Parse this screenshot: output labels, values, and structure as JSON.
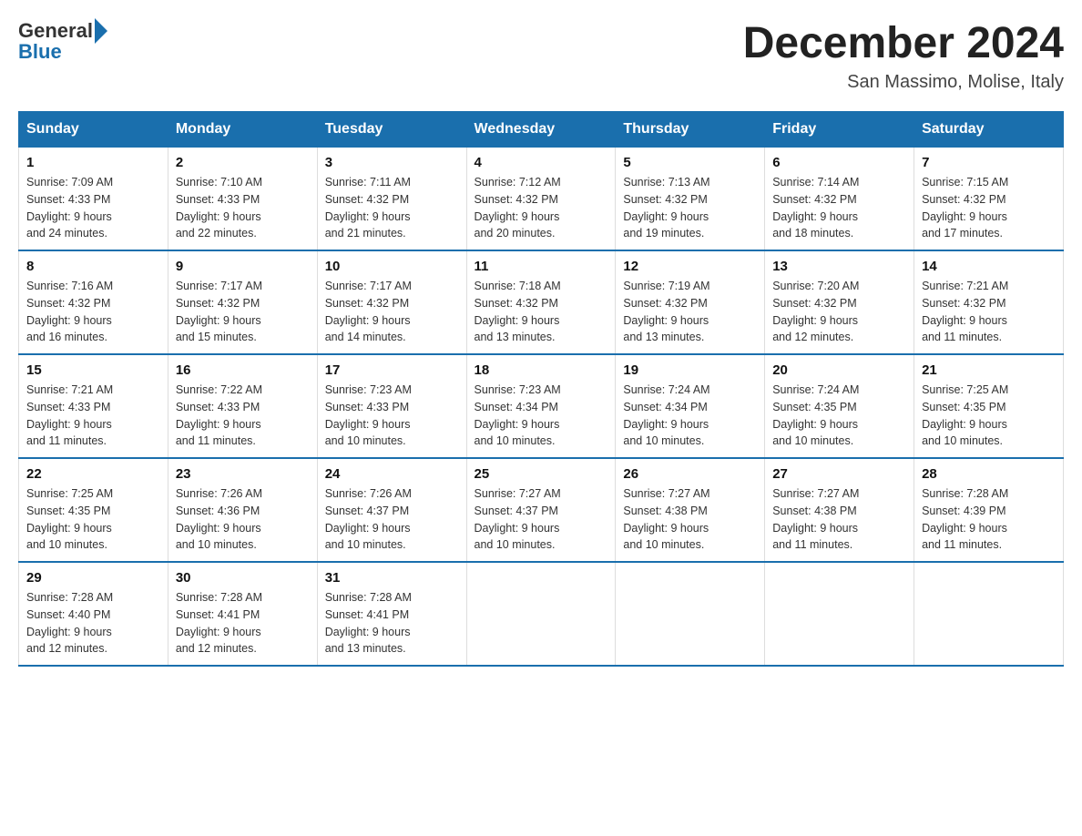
{
  "header": {
    "logo_general": "General",
    "logo_blue": "Blue",
    "month_title": "December 2024",
    "location": "San Massimo, Molise, Italy"
  },
  "weekdays": [
    "Sunday",
    "Monday",
    "Tuesday",
    "Wednesday",
    "Thursday",
    "Friday",
    "Saturday"
  ],
  "weeks": [
    [
      {
        "day": "1",
        "sunrise": "7:09 AM",
        "sunset": "4:33 PM",
        "daylight": "9 hours and 24 minutes."
      },
      {
        "day": "2",
        "sunrise": "7:10 AM",
        "sunset": "4:33 PM",
        "daylight": "9 hours and 22 minutes."
      },
      {
        "day": "3",
        "sunrise": "7:11 AM",
        "sunset": "4:32 PM",
        "daylight": "9 hours and 21 minutes."
      },
      {
        "day": "4",
        "sunrise": "7:12 AM",
        "sunset": "4:32 PM",
        "daylight": "9 hours and 20 minutes."
      },
      {
        "day": "5",
        "sunrise": "7:13 AM",
        "sunset": "4:32 PM",
        "daylight": "9 hours and 19 minutes."
      },
      {
        "day": "6",
        "sunrise": "7:14 AM",
        "sunset": "4:32 PM",
        "daylight": "9 hours and 18 minutes."
      },
      {
        "day": "7",
        "sunrise": "7:15 AM",
        "sunset": "4:32 PM",
        "daylight": "9 hours and 17 minutes."
      }
    ],
    [
      {
        "day": "8",
        "sunrise": "7:16 AM",
        "sunset": "4:32 PM",
        "daylight": "9 hours and 16 minutes."
      },
      {
        "day": "9",
        "sunrise": "7:17 AM",
        "sunset": "4:32 PM",
        "daylight": "9 hours and 15 minutes."
      },
      {
        "day": "10",
        "sunrise": "7:17 AM",
        "sunset": "4:32 PM",
        "daylight": "9 hours and 14 minutes."
      },
      {
        "day": "11",
        "sunrise": "7:18 AM",
        "sunset": "4:32 PM",
        "daylight": "9 hours and 13 minutes."
      },
      {
        "day": "12",
        "sunrise": "7:19 AM",
        "sunset": "4:32 PM",
        "daylight": "9 hours and 13 minutes."
      },
      {
        "day": "13",
        "sunrise": "7:20 AM",
        "sunset": "4:32 PM",
        "daylight": "9 hours and 12 minutes."
      },
      {
        "day": "14",
        "sunrise": "7:21 AM",
        "sunset": "4:32 PM",
        "daylight": "9 hours and 11 minutes."
      }
    ],
    [
      {
        "day": "15",
        "sunrise": "7:21 AM",
        "sunset": "4:33 PM",
        "daylight": "9 hours and 11 minutes."
      },
      {
        "day": "16",
        "sunrise": "7:22 AM",
        "sunset": "4:33 PM",
        "daylight": "9 hours and 11 minutes."
      },
      {
        "day": "17",
        "sunrise": "7:23 AM",
        "sunset": "4:33 PM",
        "daylight": "9 hours and 10 minutes."
      },
      {
        "day": "18",
        "sunrise": "7:23 AM",
        "sunset": "4:34 PM",
        "daylight": "9 hours and 10 minutes."
      },
      {
        "day": "19",
        "sunrise": "7:24 AM",
        "sunset": "4:34 PM",
        "daylight": "9 hours and 10 minutes."
      },
      {
        "day": "20",
        "sunrise": "7:24 AM",
        "sunset": "4:35 PM",
        "daylight": "9 hours and 10 minutes."
      },
      {
        "day": "21",
        "sunrise": "7:25 AM",
        "sunset": "4:35 PM",
        "daylight": "9 hours and 10 minutes."
      }
    ],
    [
      {
        "day": "22",
        "sunrise": "7:25 AM",
        "sunset": "4:35 PM",
        "daylight": "9 hours and 10 minutes."
      },
      {
        "day": "23",
        "sunrise": "7:26 AM",
        "sunset": "4:36 PM",
        "daylight": "9 hours and 10 minutes."
      },
      {
        "day": "24",
        "sunrise": "7:26 AM",
        "sunset": "4:37 PM",
        "daylight": "9 hours and 10 minutes."
      },
      {
        "day": "25",
        "sunrise": "7:27 AM",
        "sunset": "4:37 PM",
        "daylight": "9 hours and 10 minutes."
      },
      {
        "day": "26",
        "sunrise": "7:27 AM",
        "sunset": "4:38 PM",
        "daylight": "9 hours and 10 minutes."
      },
      {
        "day": "27",
        "sunrise": "7:27 AM",
        "sunset": "4:38 PM",
        "daylight": "9 hours and 11 minutes."
      },
      {
        "day": "28",
        "sunrise": "7:28 AM",
        "sunset": "4:39 PM",
        "daylight": "9 hours and 11 minutes."
      }
    ],
    [
      {
        "day": "29",
        "sunrise": "7:28 AM",
        "sunset": "4:40 PM",
        "daylight": "9 hours and 12 minutes."
      },
      {
        "day": "30",
        "sunrise": "7:28 AM",
        "sunset": "4:41 PM",
        "daylight": "9 hours and 12 minutes."
      },
      {
        "day": "31",
        "sunrise": "7:28 AM",
        "sunset": "4:41 PM",
        "daylight": "9 hours and 13 minutes."
      },
      null,
      null,
      null,
      null
    ]
  ],
  "labels": {
    "sunrise": "Sunrise:",
    "sunset": "Sunset:",
    "daylight": "Daylight:"
  }
}
